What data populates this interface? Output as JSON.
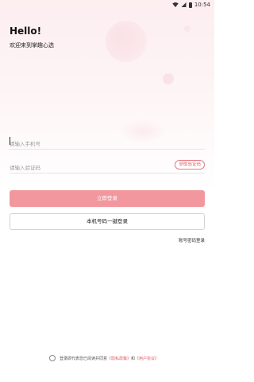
{
  "status_bar": {
    "time": "10:54"
  },
  "header": {
    "title": "Hello!",
    "subtitle": "欢迎来到掌趣心选"
  },
  "form": {
    "phone_placeholder": "请输入手机号",
    "code_placeholder": "请输入验证码",
    "get_code_label": "获取验证码"
  },
  "buttons": {
    "login_label": "立即登录",
    "onekey_label": "本机号码一键登录"
  },
  "password_login_link": "账号密码登录",
  "agreement": {
    "prefix": "登录即代表您已阅读并同意",
    "privacy_link": "《隐私政策》",
    "and": "和",
    "user_link": "《用户协议》"
  },
  "colors": {
    "accent": "#f3979f",
    "link": "#e05a66"
  }
}
